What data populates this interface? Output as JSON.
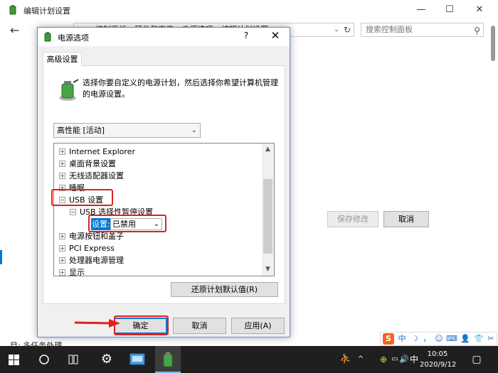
{
  "bg_window": {
    "title": "编辑计划设置",
    "minimize": "—",
    "maximize": "☐",
    "close": "✕",
    "address_text": "控制面板  ›  硬件和声音  ›  电源选项  ›  编辑计划设置",
    "search_placeholder": "搜索控制面板",
    "save_button": "保存修改",
    "cancel_button": "取消",
    "bottom_text": "多任务处理"
  },
  "dialog": {
    "title": "电源选项",
    "help": "?",
    "close": "✕",
    "tab_label": "高级设置",
    "intro": "选择你要自定义的电源计划，然后选择你希望计算机管理的电源设置。",
    "plan_selected": "高性能 [活动]",
    "tree": {
      "items": [
        {
          "exp": "+",
          "label": "Internet Explorer"
        },
        {
          "exp": "+",
          "label": "桌面背景设置"
        },
        {
          "exp": "+",
          "label": "无线适配器设置"
        },
        {
          "exp": "+",
          "label": "睡眠"
        },
        {
          "exp": "−",
          "label": "USB 设置"
        },
        {
          "exp": "−",
          "label": "USB 选择性暂停设置"
        },
        {
          "exp": "+",
          "label": "电源按钮和盖子"
        },
        {
          "exp": "+",
          "label": "PCI Express"
        },
        {
          "exp": "+",
          "label": "处理器电源管理"
        },
        {
          "exp": "+",
          "label": "显示"
        }
      ],
      "setting_label": "设置:",
      "setting_value": "已禁用"
    },
    "restore_button": "还原计划默认值(R)",
    "ok_button": "确定",
    "cancel_button": "取消",
    "apply_button": "应用(A)"
  },
  "taskbar": {
    "time": "10:05",
    "date": "2020/9/12",
    "lang": "中",
    "sound": "🔊"
  },
  "ime": {
    "logo": "S",
    "mode": "中",
    "items": [
      "☽",
      "，",
      "☺",
      "⌨",
      "👤",
      "👕",
      "✂"
    ]
  },
  "colors": {
    "accent": "#0078d7",
    "highlight_red": "#e02020",
    "taskbar_bg": "#1f1f1f"
  }
}
